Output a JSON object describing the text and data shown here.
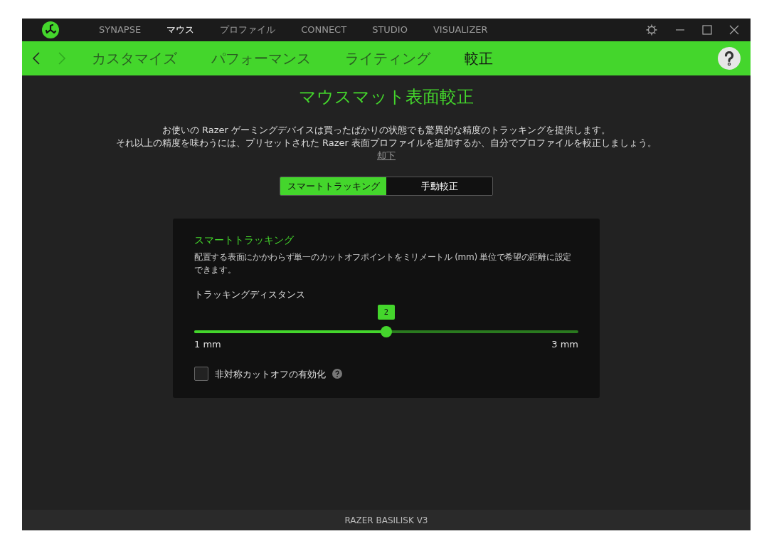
{
  "top_nav": [
    {
      "label": "SYNAPSE",
      "selected": false
    },
    {
      "label": "マウス",
      "selected": true
    },
    {
      "label": "プロファイル",
      "selected": false
    },
    {
      "label": "CONNECT",
      "selected": false
    },
    {
      "label": "STUDIO",
      "selected": false
    },
    {
      "label": "VISUALIZER",
      "selected": false
    }
  ],
  "back_enabled": true,
  "forward_enabled": false,
  "sub_tabs": [
    {
      "label": "カスタマイズ",
      "selected": false
    },
    {
      "label": "パフォーマンス",
      "selected": false
    },
    {
      "label": "ライティング",
      "selected": false
    },
    {
      "label": "較正",
      "selected": true
    }
  ],
  "page_title": "マウスマット表面較正",
  "intro": [
    "お使いの Razer ゲーミングデバイスは買ったばかりの状態でも驚異的な精度のトラッキングを提供します。",
    "それ以上の精度を味わうには、プリセットされた Razer 表面プロファイルを追加するか、自分でプロファイルを較正しましょう。"
  ],
  "dismiss_link": "却下",
  "modes": [
    {
      "label": "スマートトラッキング",
      "selected": true
    },
    {
      "label": "手動較正",
      "selected": false
    }
  ],
  "card": {
    "title": "スマートトラッキング",
    "description": "配置する表面にかかわらず単一のカットオフポイントをミリメートル (mm) 単位で希望の距離に設定できます。",
    "slider": {
      "label": "トラッキングディスタンス",
      "value": "2",
      "level": 0.5,
      "min_label": "1 mm",
      "max_label": "3 mm"
    },
    "checkbox": {
      "label": "非対称カットオフの有効化",
      "checked": false
    }
  },
  "device_name": "RAZER BASILISK V3"
}
